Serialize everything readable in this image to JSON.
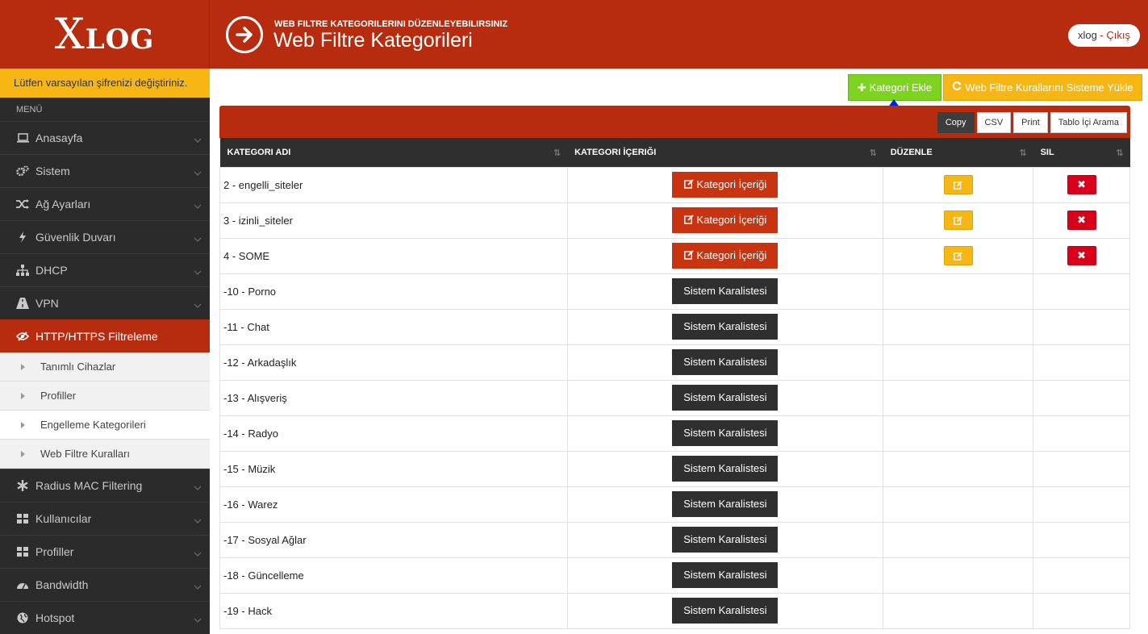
{
  "brand": {
    "logo_big": "X",
    "logo_rest": "LOG"
  },
  "header": {
    "subtitle": "WEB FILTRE KATEGORILERINI DÜZENLEYEBILIRSINIZ",
    "title": "Web Filtre Kategorileri",
    "user": "xlog",
    "separator": " - ",
    "logout_label": "Çıkış"
  },
  "sidebar": {
    "warning": "Lütfen varsayılan şifrenizi değiştiriniz.",
    "menu_heading": "MENÜ",
    "items": [
      {
        "label": "Anasayfa",
        "icon": "laptop-icon"
      },
      {
        "label": "Sistem",
        "icon": "cogs-icon"
      },
      {
        "label": "Ağ Ayarları",
        "icon": "random-icon"
      },
      {
        "label": "Güvenlik Duvarı",
        "icon": "bolt-icon"
      },
      {
        "label": "DHCP",
        "icon": "sitemap-icon"
      },
      {
        "label": "VPN",
        "icon": "road-icon"
      },
      {
        "label": "HTTP/HTTPS Filtreleme",
        "icon": "eye-slash-icon"
      }
    ],
    "sub_items": [
      {
        "label": "Tanımlı Cihazlar"
      },
      {
        "label": "Profiller"
      },
      {
        "label": "Engelleme Kategorileri"
      },
      {
        "label": "Web Filtre Kuralları"
      }
    ],
    "items_after": [
      {
        "label": "Radius MAC Filtering",
        "icon": "asterisk-icon"
      },
      {
        "label": "Kullanıcılar",
        "icon": "th-large-icon"
      },
      {
        "label": "Profiller",
        "icon": "th-large-icon"
      },
      {
        "label": "Bandwidth",
        "icon": "dashboard-icon"
      },
      {
        "label": "Hotspot",
        "icon": "globe-icon"
      }
    ]
  },
  "toolbar": {
    "add_label": "Kategori Ekle",
    "load_label": "Web Filtre Kurallarını Sisteme Yükle",
    "export_buttons": [
      "Copy",
      "CSV",
      "Print",
      "Tablo İçi Arama"
    ]
  },
  "table": {
    "columns": [
      "KATEGORI ADI",
      "KATEGORI İÇERIĞI",
      "DÜZENLE",
      "SIL"
    ],
    "content_button": "Kategori İçeriği",
    "system_button": "Sistem Karalistesi",
    "rows": [
      {
        "name": "2 - engelli_siteler",
        "type": "user"
      },
      {
        "name": "3 - izinli_siteler",
        "type": "user"
      },
      {
        "name": "4 - SOME",
        "type": "user"
      },
      {
        "name": "-10 - Porno",
        "type": "system"
      },
      {
        "name": "-11 - Chat",
        "type": "system"
      },
      {
        "name": "-12 - Arkadaşlık",
        "type": "system"
      },
      {
        "name": "-13 - Alışveriş",
        "type": "system"
      },
      {
        "name": "-14 - Radyo",
        "type": "system"
      },
      {
        "name": "-15 - Müzik",
        "type": "system"
      },
      {
        "name": "-16 - Warez",
        "type": "system"
      },
      {
        "name": "-17 - Sosyal Ağlar",
        "type": "system"
      },
      {
        "name": "-18 - Güncelleme",
        "type": "system"
      },
      {
        "name": "-19 - Hack",
        "type": "system"
      }
    ]
  },
  "colors": {
    "brand_red": "#b72c0f",
    "warning_yellow": "#f6b714",
    "success_green": "#7ed321",
    "danger_red": "#d9001b",
    "sidebar_dark": "#2b2b2b"
  }
}
